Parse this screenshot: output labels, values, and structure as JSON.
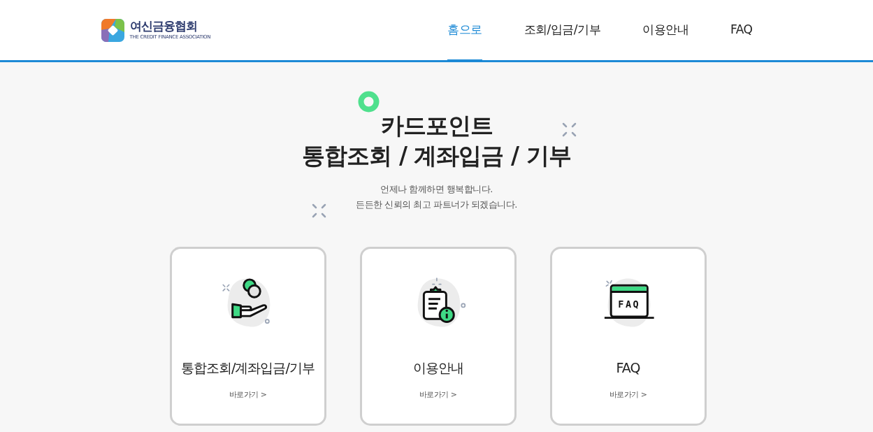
{
  "logo": {
    "name": "여신금융협회",
    "subtitle": "THE CREDIT FINANCE ASSOCIATION"
  },
  "nav": [
    {
      "label": "홈으로",
      "selected": true
    },
    {
      "label": "조회/입금/기부",
      "selected": false
    },
    {
      "label": "이용안내",
      "selected": false
    },
    {
      "label": "FAQ",
      "selected": false
    }
  ],
  "hero": {
    "title_lines": [
      "카드포인트",
      "통합조회 / 계좌입금 / 기부"
    ],
    "subtitle_lines": [
      "언제나 함께하면 행복합니다.",
      "든든한 신뢰의 최고 파트너가 되겠습니다."
    ]
  },
  "cards": [
    {
      "kind": "coins",
      "title": "통합조회/계좌입금/기부",
      "link": "바로가기 >"
    },
    {
      "kind": "clipboard",
      "title": "이용안내",
      "link": "바로가기 >"
    },
    {
      "kind": "faq",
      "icon_text": "FAQ",
      "title": "FAQ",
      "link": "바로가기 >"
    }
  ]
}
